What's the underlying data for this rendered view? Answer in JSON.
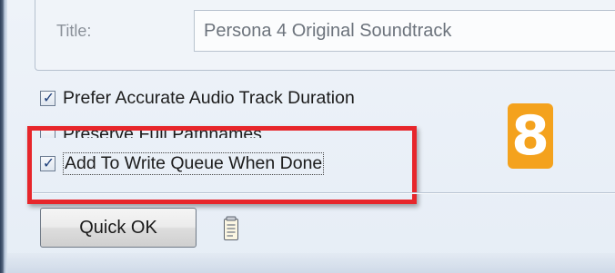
{
  "album": {
    "title_label": "Title:",
    "title_value": "Persona 4 Original Soundtrack"
  },
  "options": [
    {
      "label": "Prefer Accurate Audio Track Duration",
      "checked": true
    },
    {
      "label": "Preserve Full Pathnames",
      "checked": false
    },
    {
      "label": "Add To Write Queue When Done",
      "checked": true
    }
  ],
  "actions": {
    "quick_ok_label": "Quick OK",
    "notepad_icon": "notepad-icon"
  },
  "annotation": {
    "step_number": "8",
    "badge_color": "#f4a21d",
    "highlight_color": "#e7262b"
  }
}
